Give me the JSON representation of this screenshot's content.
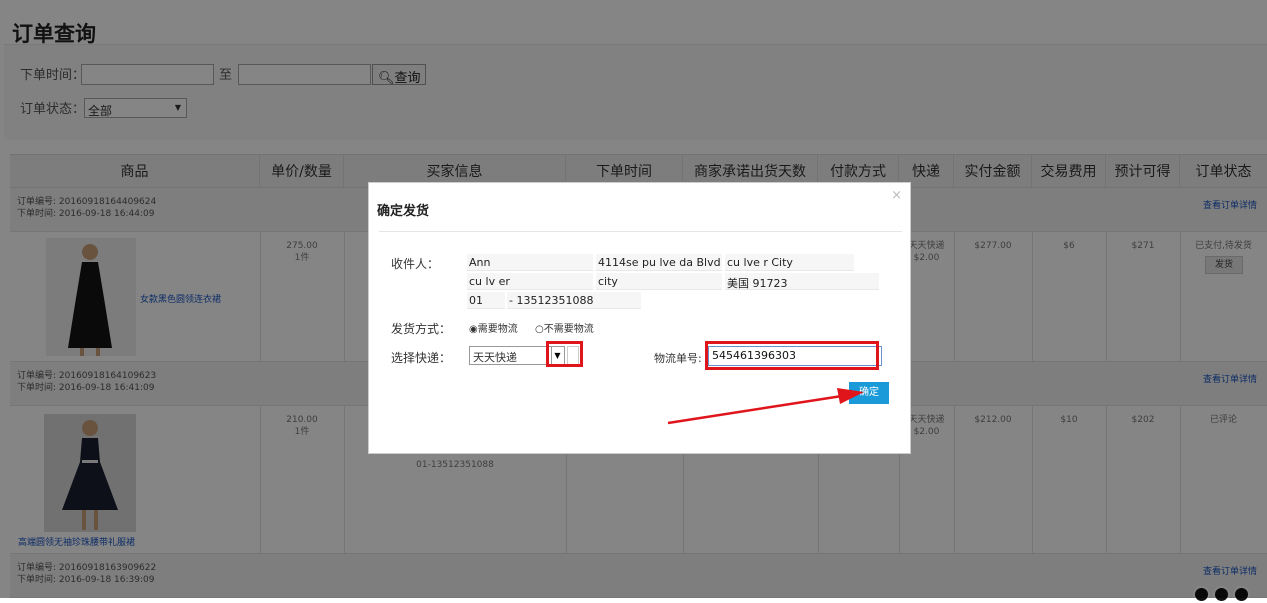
{
  "page": {
    "title": "订单查询"
  },
  "filters": {
    "order_time_label": "下单时间：",
    "to_label": "至",
    "query_button": "查询",
    "status_label": "订单状态：",
    "status_value": "全部"
  },
  "table": {
    "headers": [
      "商品",
      "单价/数量",
      "买家信息",
      "下单时间",
      "商家承诺出货天数",
      "付款方式",
      "快递",
      "实付金额",
      "交易费用",
      "预计可得",
      "订单状态"
    ]
  },
  "orders": [
    {
      "order_no": "订单编号: 20160918164409624",
      "order_time": "下单时间: 2016-09-18 16:44:09",
      "detail_link": "查看订单详情",
      "product_name": "女款黑色圆领连衣裙",
      "price": "275.00",
      "qty": "1件",
      "courier": "天天快递",
      "courier_fee": "$2.00",
      "paid": "$277.00",
      "fee": "$6",
      "earn": "$271",
      "status": "已支付,待发货",
      "ship_button": "发货"
    },
    {
      "order_no": "订单编号: 20160918164109623",
      "order_time": "下单时间: 2016-09-18 16:41:09",
      "detail_link": "查看订单详情",
      "product_name": "高端圆领无袖珍珠腰带礼服裙",
      "price": "210.00",
      "qty": "1件",
      "buyer_phone": "01-13512351088",
      "courier": "天天快递",
      "courier_fee": "$2.00",
      "paid": "$212.00",
      "fee": "$10",
      "earn": "$202",
      "status": "已评论"
    },
    {
      "order_no": "订单编号: 20160918163909622",
      "order_time": "下单时间: 2016-09-18 16:39:09",
      "detail_link": "查看订单详情"
    }
  ],
  "modal": {
    "title": "确定发货",
    "close_icon": "×",
    "recipient_label": "收件人：",
    "recipient": {
      "name": "Ann",
      "street": "4114se pu lve da Blvd",
      "city_line": "cu lve r City",
      "line2": "cu lv er",
      "city": "city",
      "country_zip": "美国 91723",
      "area_code": "01",
      "phone": "- 13512351088"
    },
    "ship_method_label": "发货方式：",
    "ship_need": "需要物流",
    "ship_no_need": "不需要物流",
    "courier_label": "选择快递：",
    "courier_value": "天天快递",
    "tracking_label": "物流单号:",
    "tracking_value": "545461396303",
    "confirm_button": "确定"
  },
  "colors": {
    "highlight": "#e0141b",
    "primary_button": "#1a9ad8",
    "link": "#1a56c4"
  }
}
